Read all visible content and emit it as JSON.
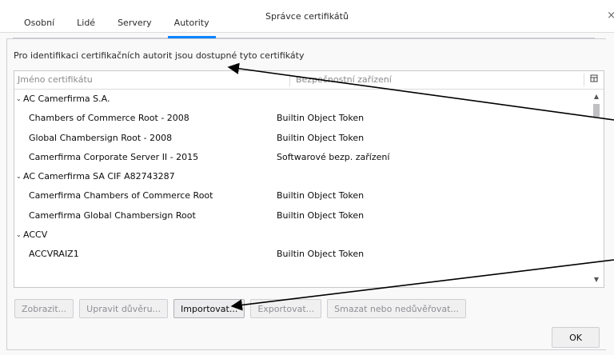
{
  "window": {
    "title": "Správce certifikátů",
    "close_glyph": "×"
  },
  "tabs": [
    {
      "label": "Osobní"
    },
    {
      "label": "Lidé"
    },
    {
      "label": "Servery"
    },
    {
      "label": "Autority",
      "active": true
    }
  ],
  "description": "Pro identifikaci certifikačních autorit jsou dostupné tyto certifikáty",
  "table": {
    "columns": {
      "name": "Jméno certifikátu",
      "device": "Bezpečnostní zařízení"
    },
    "rows": [
      {
        "type": "group",
        "name": "AC Camerfirma S.A.",
        "device": ""
      },
      {
        "type": "item",
        "name": "Chambers of Commerce Root - 2008",
        "device": "Builtin Object Token"
      },
      {
        "type": "item",
        "name": "Global Chambersign Root - 2008",
        "device": "Builtin Object Token"
      },
      {
        "type": "item",
        "name": "Camerfirma Corporate Server II - 2015",
        "device": "Softwarové bezp. zařízení"
      },
      {
        "type": "group",
        "name": "AC Camerfirma SA CIF A82743287",
        "device": ""
      },
      {
        "type": "item",
        "name": "Camerfirma Chambers of Commerce Root",
        "device": "Builtin Object Token"
      },
      {
        "type": "item",
        "name": "Camerfirma Global Chambersign Root",
        "device": "Builtin Object Token"
      },
      {
        "type": "group",
        "name": "ACCV",
        "device": ""
      },
      {
        "type": "item",
        "name": "ACCVRAIZ1",
        "device": "Builtin Object Token"
      }
    ]
  },
  "buttons": {
    "view": "Zobrazit...",
    "edit_trust": "Upravit důvěru...",
    "import": "Importovat...",
    "export": "Exportovat...",
    "delete": "Smazat nebo nedůvěřovat...",
    "ok": "OK"
  },
  "colors": {
    "accent": "#0a84ff",
    "annotation": "#000000"
  },
  "icons": {
    "expanded": "chevron-down-icon",
    "column_picker": "column-picker-icon"
  }
}
